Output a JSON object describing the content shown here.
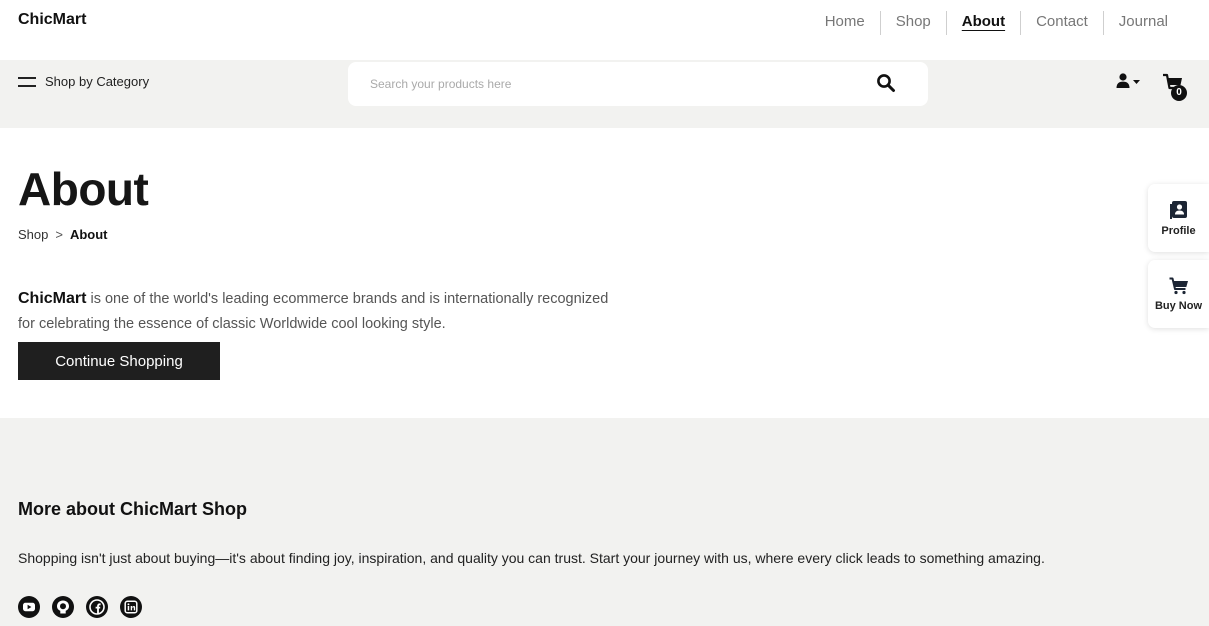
{
  "brand": {
    "name": "ChicMart"
  },
  "nav": {
    "items": [
      {
        "label": "Home",
        "active": false
      },
      {
        "label": "Shop",
        "active": false
      },
      {
        "label": "About",
        "active": true
      },
      {
        "label": "Contact",
        "active": false
      },
      {
        "label": "Journal",
        "active": false
      }
    ]
  },
  "subbar": {
    "category_label": "Shop by Category",
    "search_placeholder": "Search your products here",
    "cart_count": "0"
  },
  "main": {
    "title": "About",
    "breadcrumb": {
      "parent": "Shop",
      "separator": ">",
      "current": "About"
    },
    "intro_brand": "ChicMart",
    "intro_text": " is one of the world's leading ecommerce brands and is internationally recognized for celebrating the essence of classic Worldwide cool looking style.",
    "cta_label": "Continue Shopping"
  },
  "side_widgets": {
    "profile_label": "Profile",
    "buy_now_label": "Buy Now"
  },
  "footer": {
    "title": "More about ChicMart Shop",
    "text": "Shopping isn't just about buying—it's about finding joy, inspiration, and quality you can trust. Start your journey with us, where every click leads to something amazing.",
    "socials": [
      "youtube-icon",
      "github-icon",
      "facebook-icon",
      "linkedin-icon"
    ]
  },
  "colors": {
    "subbar_bg": "#f2f2f0",
    "footer_bg": "#f2f2f0",
    "button_bg": "#1f1f1f"
  }
}
